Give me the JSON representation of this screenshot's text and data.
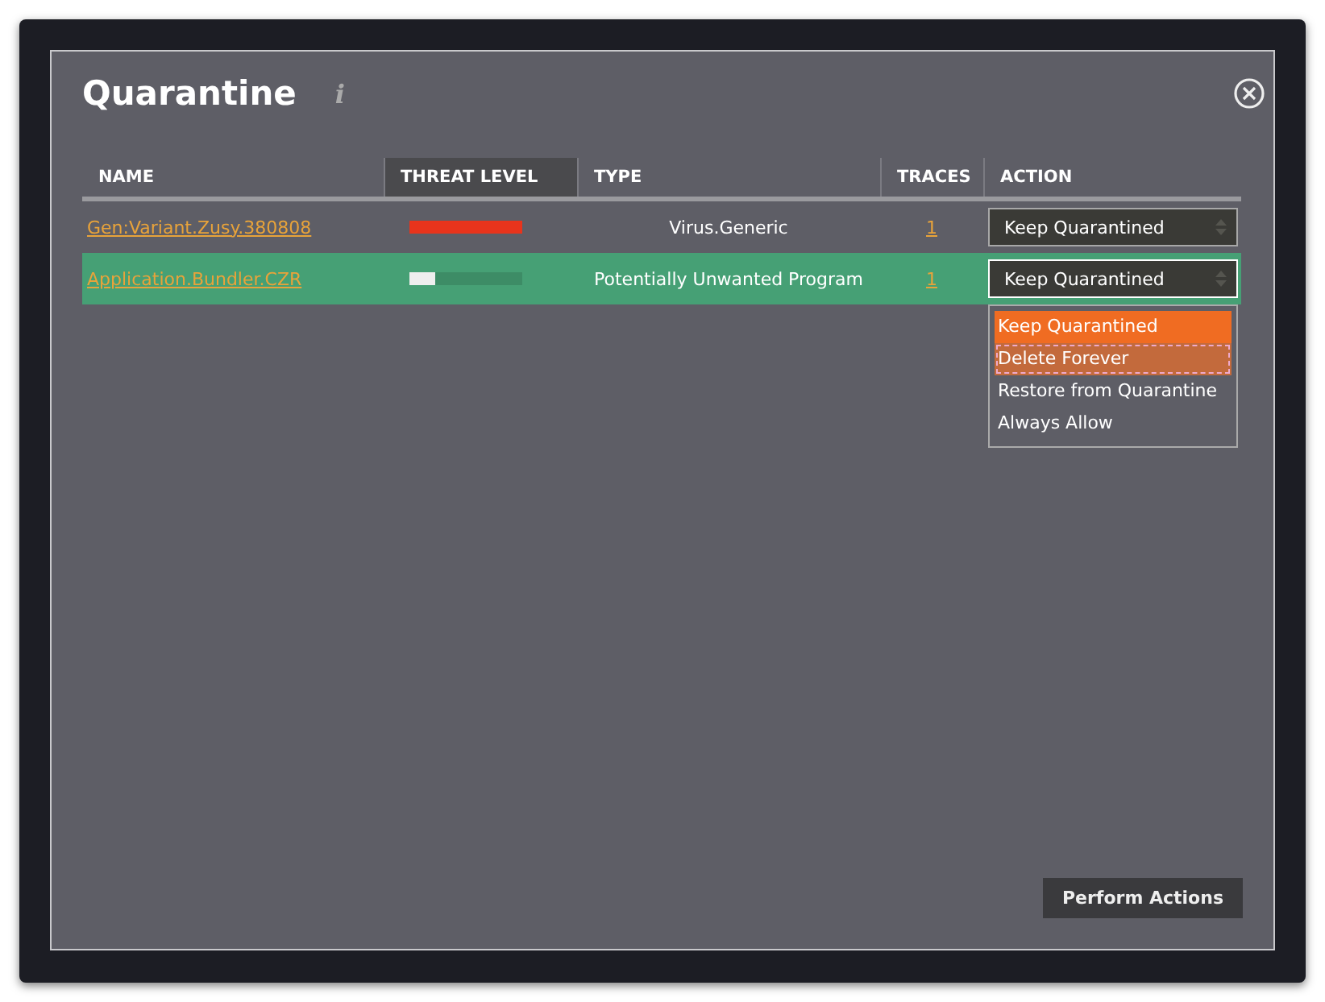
{
  "dialog": {
    "title": "Quarantine",
    "info_icon": "i"
  },
  "table": {
    "columns": [
      {
        "label": "NAME",
        "sorted": false
      },
      {
        "label": "THREAT LEVEL",
        "sorted": true
      },
      {
        "label": "TYPE",
        "sorted": false
      },
      {
        "label": "TRACES",
        "sorted": false
      },
      {
        "label": "ACTION",
        "sorted": false
      }
    ],
    "rows": [
      {
        "name": "Gen:Variant.Zusy.380808",
        "threat": {
          "level": 1.0,
          "color": "#e8341c"
        },
        "type": "Virus.Generic",
        "traces": "1",
        "action": "Keep Quarantined",
        "selected": false,
        "expanded": false
      },
      {
        "name": "Application.Bundler.CZR",
        "threat": {
          "level": 0.23,
          "color": "#eeeeee"
        },
        "type": "Potentially Unwanted Program",
        "traces": "1",
        "action": "Keep Quarantined",
        "selected": true,
        "expanded": true
      }
    ]
  },
  "dropdown_options": [
    {
      "label": "Keep Quarantined",
      "selected": true,
      "hovered": false
    },
    {
      "label": "Delete Forever",
      "selected": false,
      "hovered": true
    },
    {
      "label": "Restore from Quarantine",
      "selected": false,
      "hovered": false
    },
    {
      "label": "Always Allow",
      "selected": false,
      "hovered": false
    }
  ],
  "buttons": [
    {
      "label": "Perform Actions"
    }
  ]
}
